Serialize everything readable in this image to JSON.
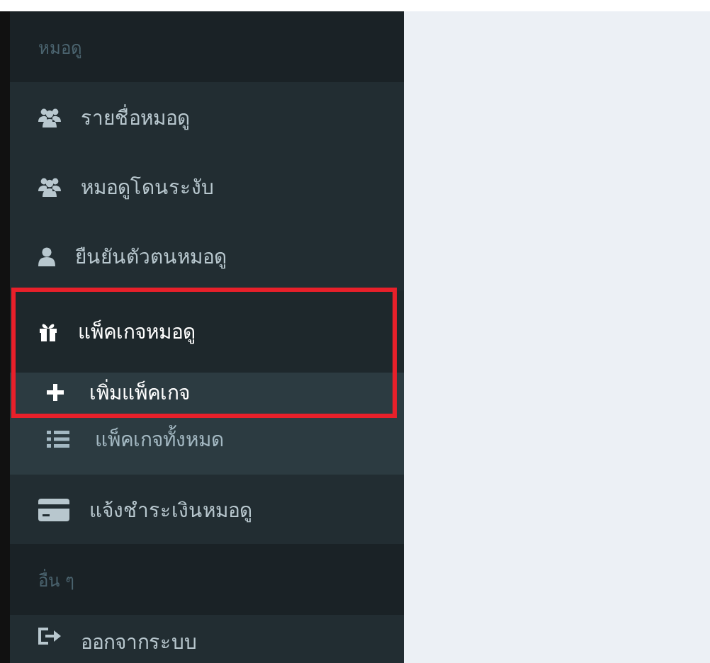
{
  "sidebar": {
    "sections": [
      {
        "header": "หมอดู",
        "items": [
          {
            "label": "รายชื่อหมอดู",
            "kind": "users",
            "selected": false,
            "expanded": false
          },
          {
            "label": "หมอดูโดนระงับ",
            "kind": "users",
            "selected": false,
            "expanded": false
          },
          {
            "label": "ยืนยันตัวตนหมอดู",
            "kind": "user",
            "selected": false,
            "expanded": false
          },
          {
            "label": "แพ็คเกจหมอดู",
            "kind": "gift",
            "selected": true,
            "expanded": true,
            "children": [
              {
                "label": "เพิ่มแพ็คเกจ",
                "kind": "plus",
                "selected": true
              },
              {
                "label": "แพ็คเกจทั้งหมด",
                "kind": "list",
                "selected": false
              }
            ]
          },
          {
            "label": "แจ้งชำระเงินหมอดู",
            "kind": "card",
            "selected": false,
            "expanded": false
          }
        ]
      },
      {
        "header": "อื่น ๆ",
        "items": [
          {
            "label": "ออกจากระบบ",
            "kind": "signout",
            "selected": false,
            "expanded": false
          }
        ]
      }
    ]
  }
}
